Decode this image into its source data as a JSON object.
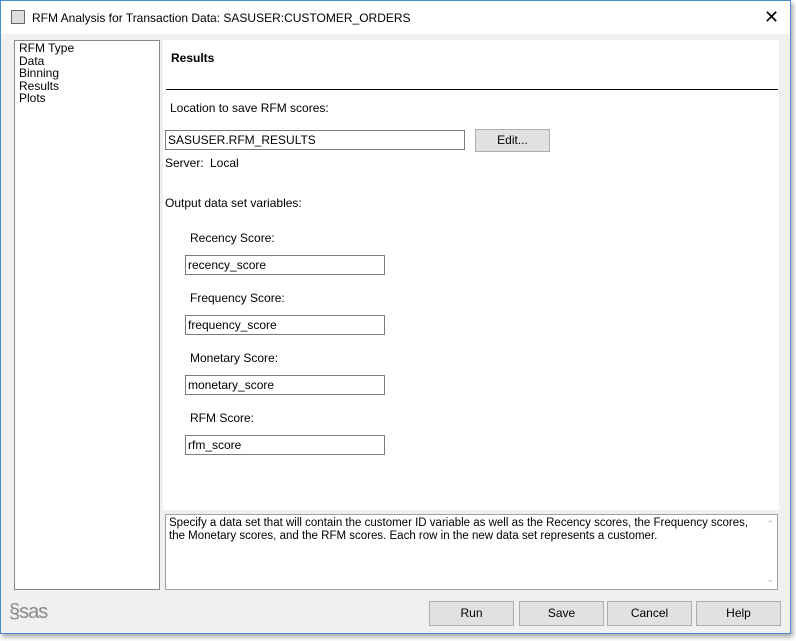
{
  "window": {
    "title": "RFM Analysis for Transaction Data: SASUSER:CUSTOMER_ORDERS",
    "close": "✕"
  },
  "nav": {
    "items": [
      "RFM Type",
      "Data",
      "Binning",
      "Results",
      "Plots"
    ]
  },
  "results": {
    "header": "Results",
    "location_label": "Location to save RFM scores:",
    "location_value": "SASUSER.RFM_RESULTS",
    "edit_label": "Edit...",
    "server_label": "Server:",
    "server_value": "Local",
    "output_label": "Output data set variables:",
    "fields": [
      {
        "label": "Recency Score:",
        "value": "recency_score"
      },
      {
        "label": "Frequency Score:",
        "value": "frequency_score"
      },
      {
        "label": "Monetary Score:",
        "value": "monetary_score"
      },
      {
        "label": "RFM Score:",
        "value": "rfm_score"
      }
    ]
  },
  "help_text": "Specify a data set that will contain the customer ID variable as well as the Recency scores, the Frequency scores, the Monetary scores, and the RFM scores.  Each row in the new data set represents a customer.",
  "footer": {
    "logo": "sas",
    "run": "Run",
    "save": "Save",
    "cancel": "Cancel",
    "help": "Help"
  }
}
